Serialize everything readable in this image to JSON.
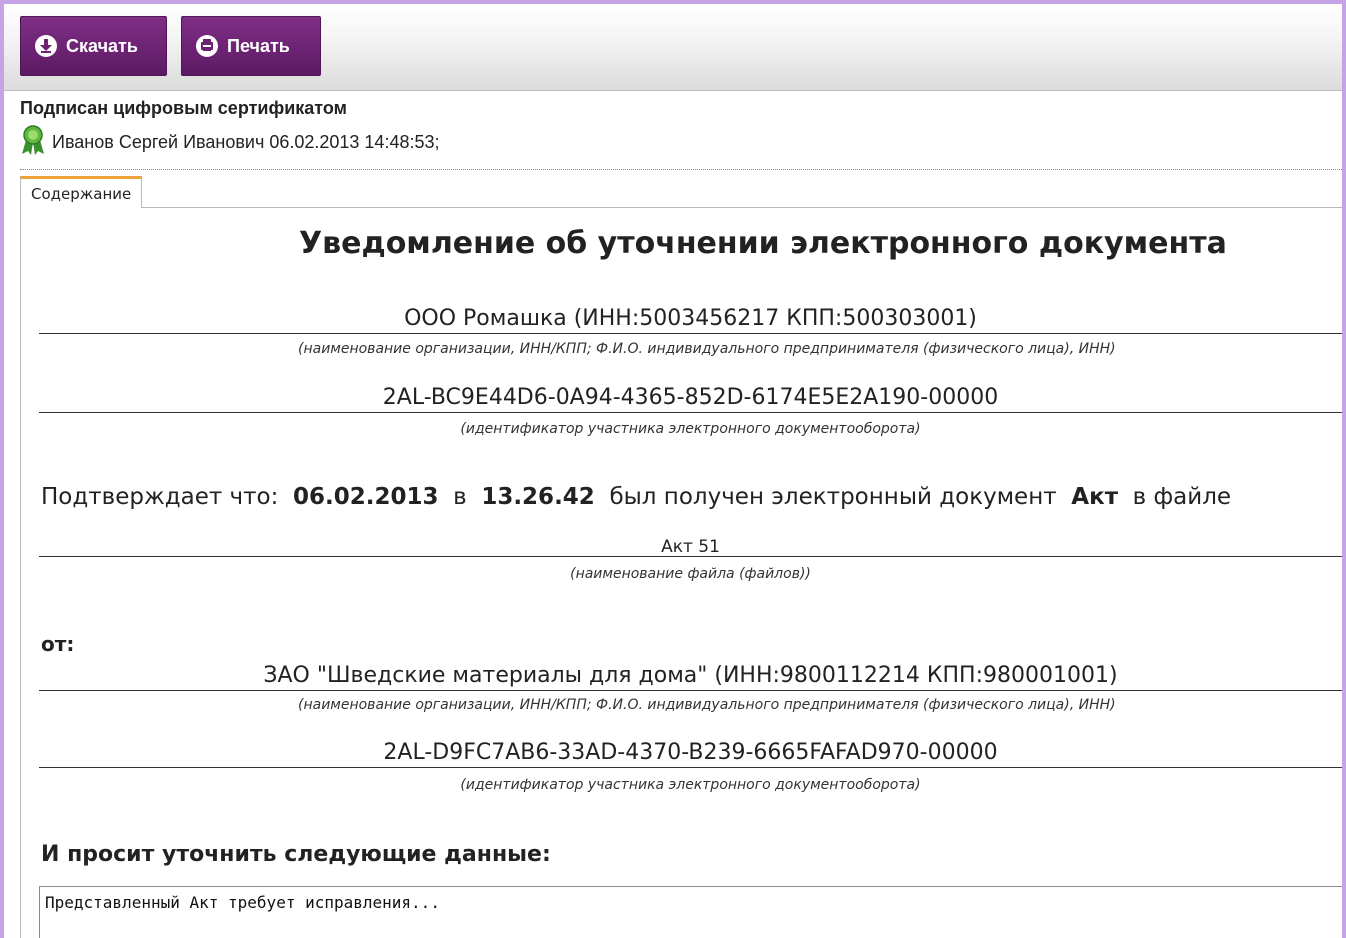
{
  "toolbar": {
    "download_label": "Скачать",
    "print_label": "Печать"
  },
  "signature": {
    "title": "Подписан цифровым сертификатом",
    "signer": "Иванов Сергей Иванович 06.02.2013 14:48:53;"
  },
  "tabs": [
    {
      "label": "Содержание",
      "active": true
    }
  ],
  "document": {
    "title": "Уведомление об уточнении электронного документа",
    "recipient": {
      "name": "ООО Ромашка (ИНН:5003456217 КПП:500303001)",
      "name_hint": "(наименование организации, ИНН/КПП; Ф.И.О. индивидуального предпринимателя (физического лица), ИНН)",
      "id": "2AL-BC9E44D6-0A94-4365-852D-6174E5E2A190-00000",
      "id_hint": "(идентификатор участника электронного документооборота)"
    },
    "confirm": {
      "prefix": "Подтверждает что:",
      "date": "06.02.2013",
      "in_word": "в",
      "time": "13.26.42",
      "received_text": "был получен электронный документ",
      "doc_type": "Акт",
      "in_file_text": "в файле"
    },
    "file": {
      "name": "Акт 51",
      "hint": "(наименование файла (файлов))"
    },
    "from_label": "от:",
    "sender": {
      "name": "ЗАО \"Шведские материалы для дома\" (ИНН:9800112214 КПП:980001001)",
      "name_hint": "(наименование организации, ИНН/КПП; Ф.И.О. индивидуального предпринимателя (физического лица), ИНН)",
      "id": "2AL-D9FC7AB6-33AD-4370-B239-6665FAFAD970-00000",
      "id_hint": "(идентификатор участника электронного документооборота)"
    },
    "request_label": "И просит уточнить следующие данные:",
    "request_text": "Представленный Акт требует исправления..."
  },
  "colors": {
    "button_bg": "#6d2374",
    "frame_border": "#c6a3e6",
    "tab_accent": "#f0a23a"
  },
  "icons": {
    "download": "download-circle-icon",
    "print": "print-circle-icon",
    "signature": "award-ribbon-icon"
  }
}
